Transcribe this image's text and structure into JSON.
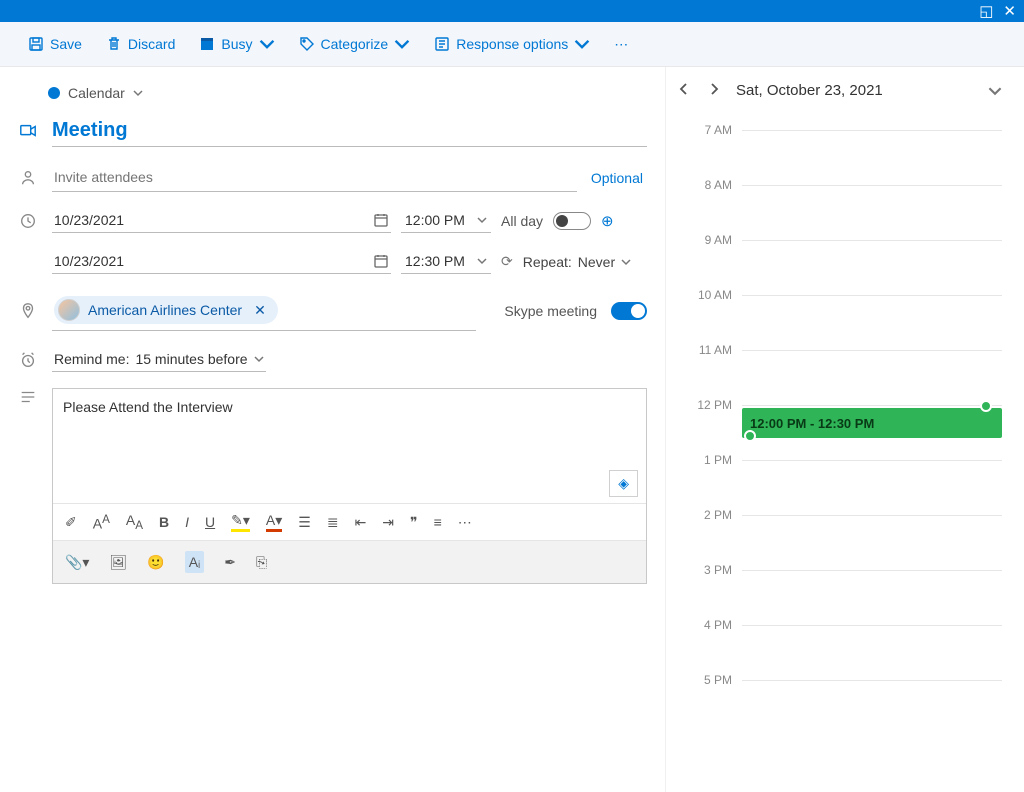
{
  "toolbar": {
    "save": "Save",
    "discard": "Discard",
    "busy": "Busy",
    "categorize": "Categorize",
    "response": "Response options"
  },
  "calendar_label": "Calendar",
  "form": {
    "title": "Meeting",
    "invite_placeholder": "Invite attendees",
    "optional": "Optional",
    "start_date": "10/23/2021",
    "start_time": "12:00 PM",
    "end_date": "10/23/2021",
    "end_time": "12:30 PM",
    "all_day": "All day",
    "repeat_label": "Repeat:",
    "repeat_value": "Never",
    "location": "American Airlines Center",
    "skype": "Skype meeting",
    "remind_label": "Remind me:",
    "remind_value": "15 minutes before",
    "body": "Please Attend the Interview"
  },
  "side": {
    "date": "Sat, October 23, 2021",
    "hours": [
      "7 AM",
      "8 AM",
      "9 AM",
      "10 AM",
      "11 AM",
      "12 PM",
      "1 PM",
      "2 PM",
      "3 PM",
      "4 PM",
      "5 PM"
    ],
    "event_label": "12:00 PM - 12:30 PM"
  }
}
